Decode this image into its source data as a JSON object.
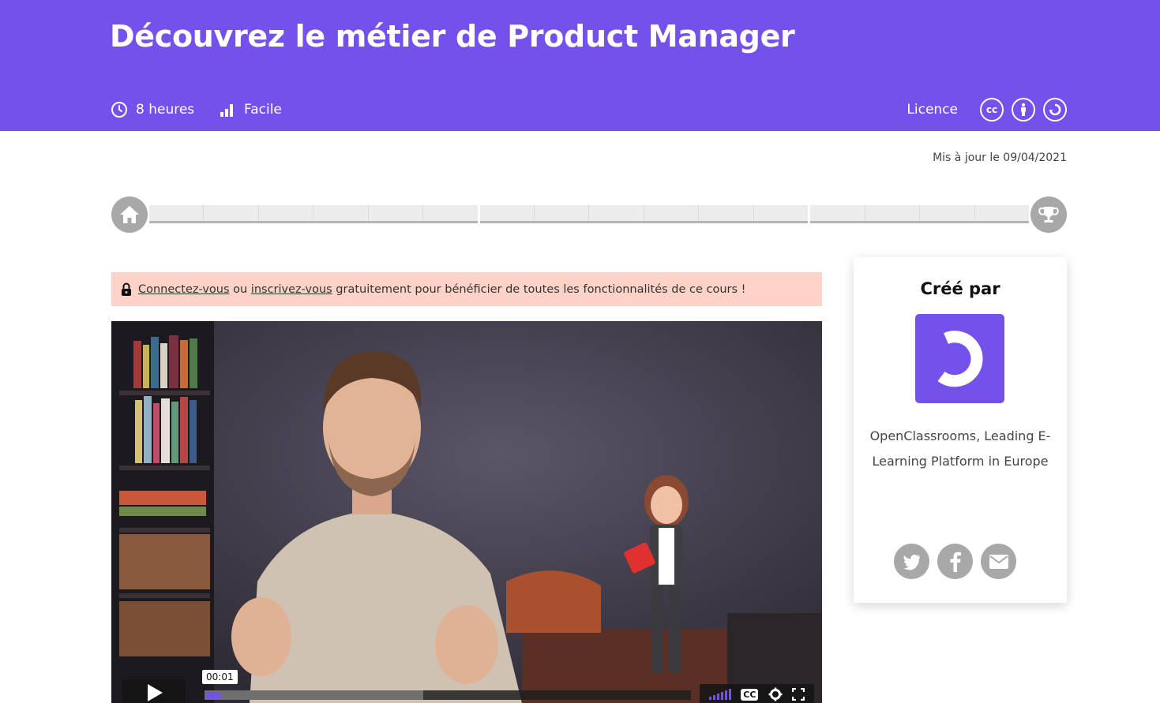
{
  "course": {
    "title": "Découvrez le métier de Product Manager",
    "duration": "8 heures",
    "level": "Facile",
    "licence_label": "Licence",
    "licence_icons": [
      "cc-icon",
      "attribution-icon",
      "sharealike-icon"
    ],
    "updated": "Mis à jour le 09/04/2021"
  },
  "progress": {
    "parts": [
      6,
      6,
      4
    ],
    "start_icon": "home-icon",
    "end_icon": "trophy-icon"
  },
  "notice": {
    "login_link": "Connectez-vous",
    "connector": " ou ",
    "signup_link": "inscrivez-vous",
    "rest": " gratuitement pour bénéficier de toutes les fonctionnalités de ce cours !"
  },
  "video": {
    "timecode": "00:01",
    "progress_fraction": 0.03,
    "buffered_fraction": 0.45,
    "cc_label": "CC"
  },
  "creator": {
    "heading": "Créé par",
    "description": "OpenClassrooms, Leading E-Learning Platform in Europe",
    "share": [
      "twitter-icon",
      "facebook-icon",
      "mail-icon"
    ]
  },
  "colors": {
    "brand": "#7451eb",
    "notice_bg": "#fdd3c8",
    "icon_grey": "#a8a8a8"
  }
}
